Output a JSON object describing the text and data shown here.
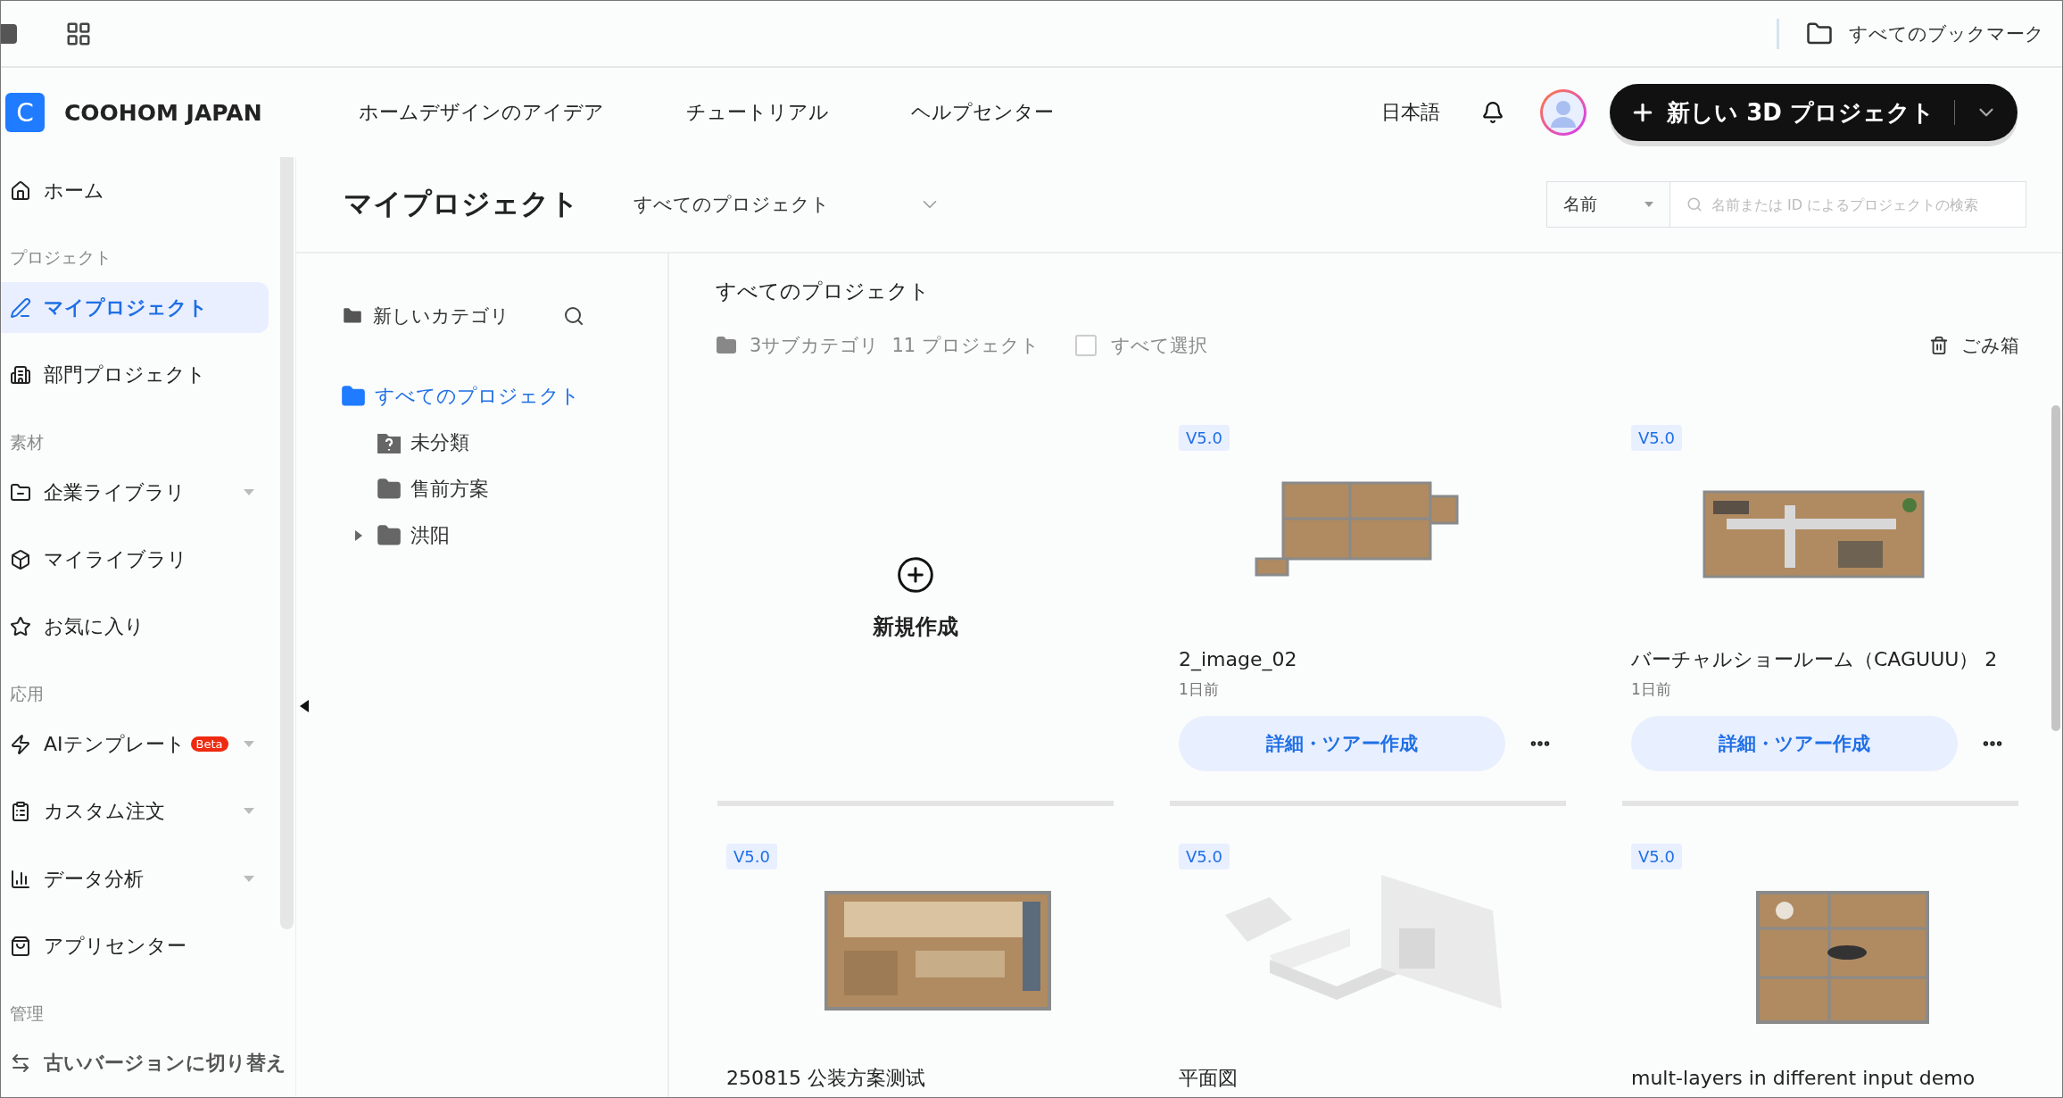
{
  "browser_bar": {
    "bookmarks": "すべてのブックマーク"
  },
  "header": {
    "logo_letter": "C",
    "brand": "COOHOM JAPAN",
    "nav": [
      "ホームデザインのアイデア",
      "チュートリアル",
      "ヘルプセンター"
    ],
    "language": "日本語",
    "new_project": "新しい 3D プロジェクト"
  },
  "sidebar": {
    "groups": [
      {
        "items": [
          {
            "kind": "nav",
            "label": "ホーム",
            "selected": false,
            "has_menu": false
          }
        ]
      },
      {
        "heading": "プロジェクト",
        "items": [
          {
            "kind": "nav",
            "label": "マイプロジェクト",
            "selected": true,
            "has_menu": false
          },
          {
            "kind": "nav",
            "label": "部門プロジェクト",
            "selected": false,
            "has_menu": false
          }
        ]
      },
      {
        "heading": "素材",
        "items": [
          {
            "kind": "nav",
            "label": "企業ライブラリ",
            "selected": false,
            "has_menu": true
          },
          {
            "kind": "nav",
            "label": "マイライブラリ",
            "selected": false,
            "has_menu": false
          },
          {
            "kind": "nav",
            "label": "お気に入り",
            "selected": false,
            "has_menu": false
          }
        ]
      },
      {
        "heading": "応用",
        "items": [
          {
            "kind": "nav",
            "label": "AIテンプレート",
            "badge": "Beta",
            "selected": false,
            "has_menu": true
          },
          {
            "kind": "nav",
            "label": "カスタム注文",
            "selected": false,
            "has_menu": true
          },
          {
            "kind": "nav",
            "label": "データ分析",
            "selected": false,
            "has_menu": true
          },
          {
            "kind": "nav",
            "label": "アプリセンター",
            "selected": false,
            "has_menu": false
          }
        ]
      },
      {
        "heading": "管理",
        "items": [
          {
            "kind": "switch",
            "label": "古いバージョンに切り替え",
            "selected": false,
            "has_menu": false
          }
        ]
      }
    ]
  },
  "page": {
    "title": "マイプロジェクト",
    "filter": "すべてのプロジェクト",
    "search_by": "名前",
    "search_placeholder": "名前または ID によるプロジェクトの検索"
  },
  "tree": {
    "new_category": "新しいカテゴリ",
    "items": [
      {
        "label": "すべてのプロジェクト",
        "selected": true,
        "children": [
          {
            "kind": "unsorted",
            "label": "未分類",
            "selected": false
          },
          {
            "kind": "folder",
            "label": "售前方案",
            "selected": false
          },
          {
            "kind": "folder",
            "label": "洪阳",
            "selected": false,
            "expanded": false
          }
        ]
      }
    ]
  },
  "grid": {
    "heading": "すべてのプロジェクト",
    "subcategories": "3サブカテゴリ",
    "count": "11 プロジェクト",
    "select_all": {
      "label": "すべて選択",
      "checked": false
    },
    "trash": "ごみ箱",
    "create": "新規作成",
    "projects": [
      {
        "version": "V5.0",
        "name": "2_image_02",
        "time": "1日前",
        "action": "詳細・ツアー作成"
      },
      {
        "version": "V5.0",
        "name": "バーチャルショールーム（CAGUUU） 2",
        "time": "1日前",
        "action": "詳細・ツアー作成"
      },
      {
        "version": "V5.0",
        "name": "250815 公装方案测试"
      },
      {
        "version": "V5.0",
        "name": "平面図"
      },
      {
        "version": "V5.0",
        "name": "mult-layers in different input demo"
      }
    ]
  }
}
